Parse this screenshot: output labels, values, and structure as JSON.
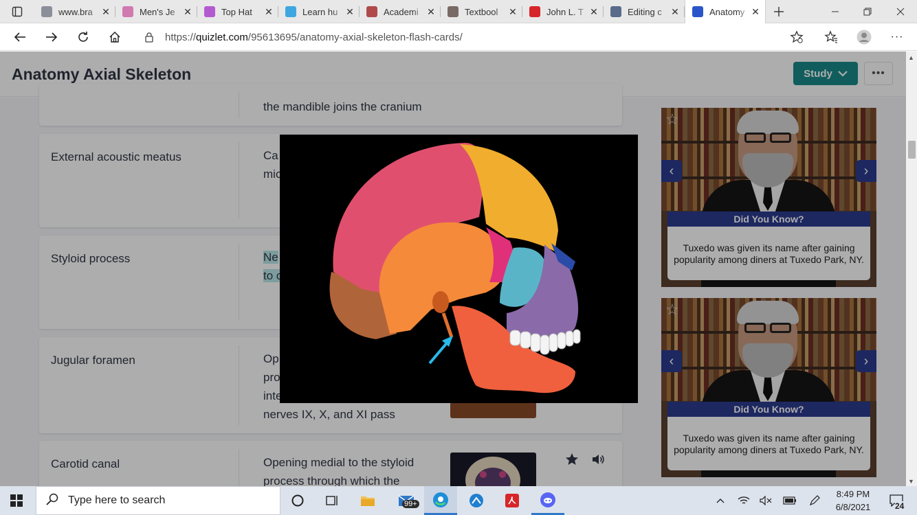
{
  "browser": {
    "tabs": [
      {
        "label": "www.bra",
        "icon": "cloud-icon",
        "color": "#8a8f99"
      },
      {
        "label": "Men's Je",
        "icon": "kohls-icon",
        "color": "#d07ab0"
      },
      {
        "label": "Top Hat",
        "icon": "tophat-icon",
        "color": "#b45ad1"
      },
      {
        "label": "Learn hu",
        "icon": "k-icon",
        "color": "#3fa7e0"
      },
      {
        "label": "Academi",
        "icon": "my-icon",
        "color": "#b04a4a"
      },
      {
        "label": "Textbool",
        "icon": "textbook-icon",
        "color": "#7a6a66"
      },
      {
        "label": "John L. T",
        "icon": "pdf-icon",
        "color": "#d7262a"
      },
      {
        "label": "Editing c",
        "icon": "editing-icon",
        "color": "#5a6b8a"
      },
      {
        "label": "Anatomy",
        "icon": "quizlet-icon",
        "color": "#2b56c9"
      }
    ],
    "url_prefix": "https://",
    "url_host": "quizlet.com",
    "url_path": "/95613695/anatomy-axial-skeleton-flash-cards/"
  },
  "page": {
    "title": "Anatomy Axial Skeleton",
    "study_label": "Study",
    "more_label": "•••"
  },
  "cards": [
    {
      "term": "",
      "def_lines": [
        "the mandible joins the cranium"
      ]
    },
    {
      "term": "External acoustic meatus",
      "def_lines": [
        "Ca",
        "mic"
      ]
    },
    {
      "term": "Styloid process",
      "def_lines": [
        "Ne",
        "to c"
      ]
    },
    {
      "term": "Jugular foramen",
      "def_lines": [
        "Op",
        "pro",
        "inte",
        "nerves IX, X, and XI pass"
      ]
    },
    {
      "term": "Carotid canal",
      "def_lines": [
        "Opening medial to the styloid",
        "process through which the"
      ]
    }
  ],
  "ads": [
    {
      "heading": "Did You Know?",
      "fact": "Tuxedo was given its name after gaining popularity among diners at Tuxedo Park, NY."
    },
    {
      "heading": "Did You Know?",
      "fact": "Tuxedo was given its name after gaining popularity among diners at Tuxedo Park, NY."
    }
  ],
  "taskbar": {
    "search_placeholder": "Type here to search",
    "mail_badge": "99+",
    "time": "8:49 PM",
    "date": "6/8/2021",
    "notification_count": "24"
  },
  "colors": {
    "study_button": "#1a8a8a",
    "ad_band": "#2b3b8f",
    "highlight": "#b9e6e8"
  }
}
